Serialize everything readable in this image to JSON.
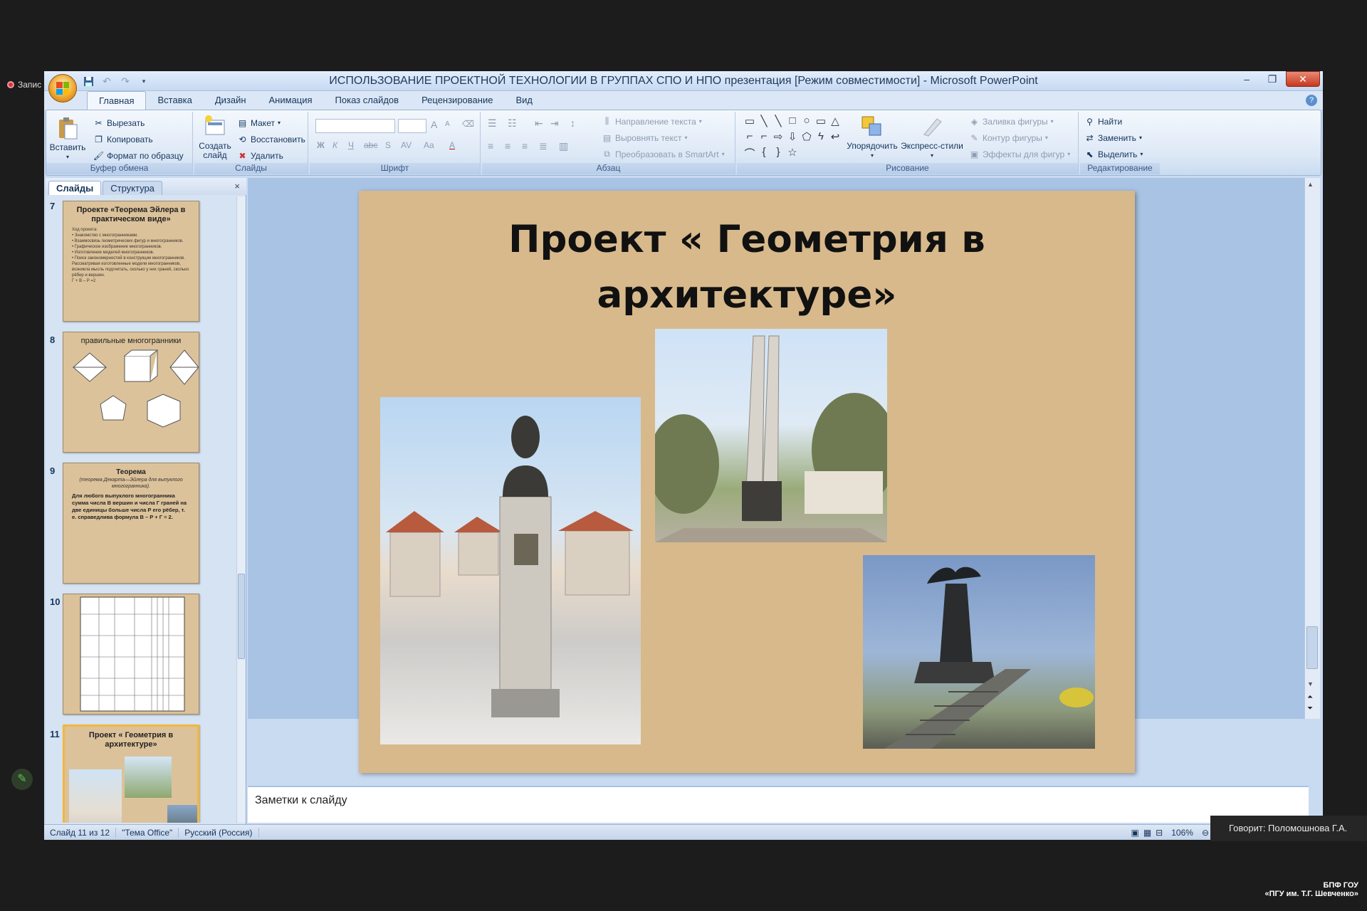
{
  "recording": {
    "label": "Запис"
  },
  "window": {
    "title": "ИСПОЛЬЗОВАНИЕ ПРОЕКТНОЙ ТЕХНОЛОГИИ В ГРУППАХ СПО И НПО презентация [Режим совместимости] - Microsoft PowerPoint",
    "controls": {
      "minimize": "–",
      "restore": "❐",
      "close": "✕"
    }
  },
  "ribbon_tabs": [
    "Главная",
    "Вставка",
    "Дизайн",
    "Анимация",
    "Показ слайдов",
    "Рецензирование",
    "Вид"
  ],
  "ribbon": {
    "clipboard": {
      "paste": "Вставить",
      "cut": "Вырезать",
      "copy": "Копировать",
      "format_painter": "Формат по образцу",
      "label": "Буфер обмена"
    },
    "slides": {
      "new_slide_1": "Создать",
      "new_slide_2": "слайд",
      "layout": "Макет",
      "reset": "Восстановить",
      "delete": "Удалить",
      "label": "Слайды"
    },
    "font": {
      "label": "Шрифт",
      "bold": "Ж",
      "italic": "К",
      "underline": "Ч",
      "strike": "abc",
      "shadow": "S",
      "spacing": "AV",
      "case": "Aa",
      "color": "A",
      "grow": "A",
      "shrink": "A"
    },
    "paragraph": {
      "text_direction": "Направление текста",
      "align_text": "Выровнять текст",
      "smartart": "Преобразовать в SmartArt",
      "label": "Абзац"
    },
    "drawing": {
      "arrange": "Упорядочить",
      "quick_styles": "Экспресс-стили",
      "shape_fill": "Заливка фигуры",
      "shape_outline": "Контур фигуры",
      "shape_effects": "Эффекты для фигур",
      "label": "Рисование",
      "shapes": [
        "▭",
        "╲",
        "╲",
        "□",
        "○",
        "▭",
        "△",
        "⌐",
        "⌐",
        "⇨",
        "⇩",
        "⬠",
        "ϟ",
        "↩",
        "⌒",
        "{",
        "}",
        "☆"
      ]
    },
    "editing": {
      "find": "Найти",
      "replace": "Заменить",
      "select": "Выделить",
      "label": "Редактирование"
    }
  },
  "panel": {
    "tabs": [
      "Слайды",
      "Структура"
    ],
    "close": "×",
    "thumbs": [
      {
        "num": "7",
        "title": "Проекте «Теорема Эйлера в практическом виде»",
        "lines": [
          "Ход проекта:",
          "• Знакомство с многогранниками.",
          "• Взаимосвязь геометрических фигур и многогранников.",
          "• Графическое изображение многогранников.",
          "• Изготовление моделей многогранников.",
          "• Поиск закономерностей в конструкции многогранников.",
          "Рассматривая изготовленные модели многогранников, возникла мысль подсчитать, сколько у них граней, сколько рёбер и вершин.",
          "Г + В – Р =2"
        ]
      },
      {
        "num": "8",
        "title": "правильные многогранники"
      },
      {
        "num": "9",
        "title": "Теорема",
        "subtitle": "(теорема Декарта—Эйлера для выпуклого многогранника).",
        "body": "Для любого выпуклого многогранника сумма числа В вершин и числа Г граней на две единицы больше числа Р его рёбер, т. е. справедлива формула В – Р + Г = 2."
      },
      {
        "num": "10",
        "title": ""
      },
      {
        "num": "11",
        "title": "Проект « Геометрия в архитектуре»"
      }
    ]
  },
  "slide": {
    "title": "Проект « Геометрия в архитектуре»"
  },
  "notes": {
    "placeholder": "Заметки к слайду"
  },
  "status": {
    "slide_info": "Слайд 11 из 12",
    "theme": "\"Тема Office\"",
    "language": "Русский (Россия)",
    "zoom": "106%"
  },
  "speaker": {
    "text": "Говорит: Поломошнова  Г.А."
  },
  "logo": {
    "line1": "БПФ ГОУ",
    "line2": "«ПГУ им. Т.Г. Шевченко»"
  },
  "colors": {
    "accent": "#c9dbf1",
    "slide_bg": "#d8b98b",
    "close": "#c8381d"
  }
}
